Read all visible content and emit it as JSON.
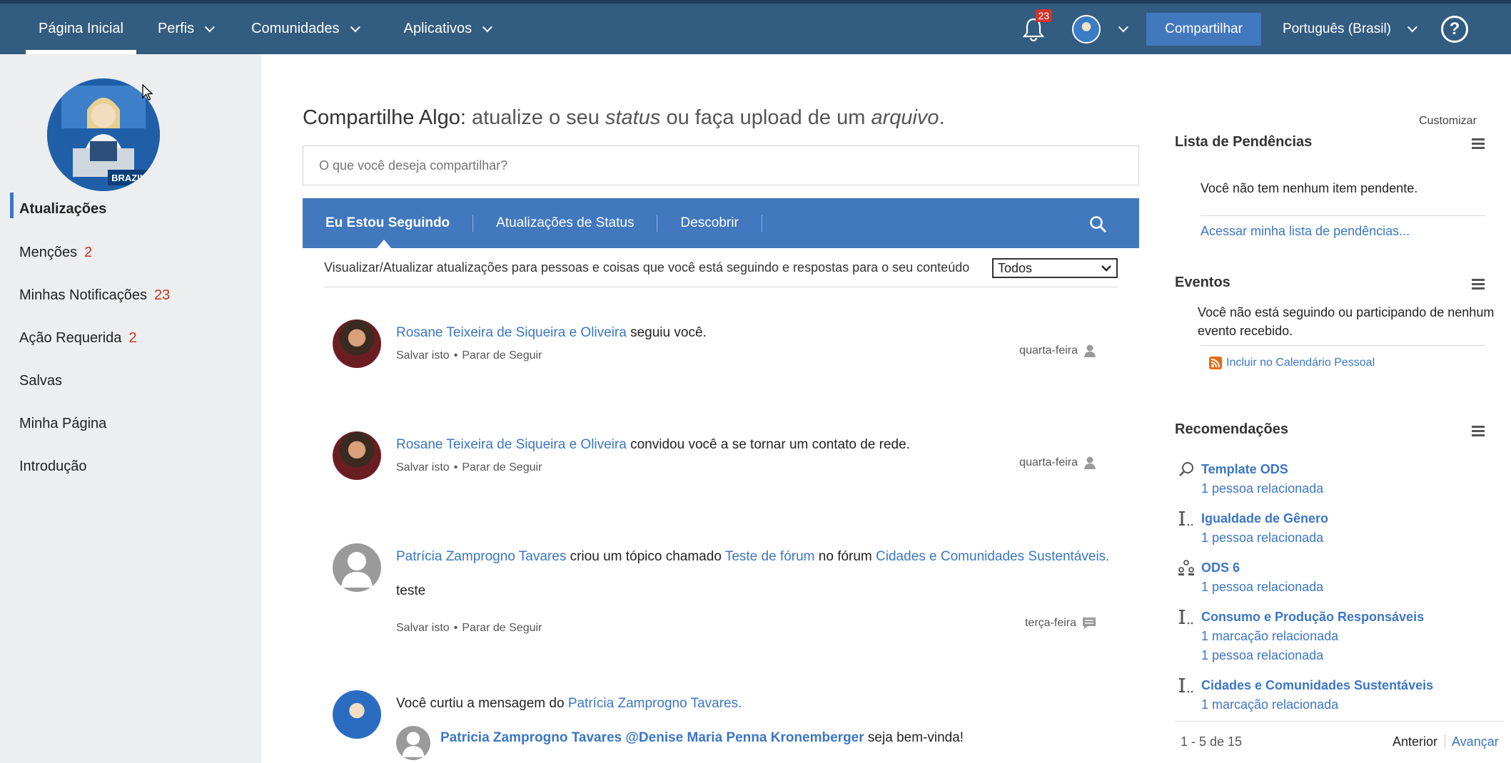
{
  "nav": {
    "home": "Página Inicial",
    "profiles": "Perfis",
    "communities": "Comunidades",
    "apps": "Aplicativos",
    "notifications_count": "23",
    "share": "Compartilhar",
    "language": "Português (Brasil)",
    "help": "?"
  },
  "sidebar": {
    "items": [
      {
        "label": "Atualizações",
        "count": ""
      },
      {
        "label": "Menções",
        "count": "2"
      },
      {
        "label": "Minhas Notificações",
        "count": "23"
      },
      {
        "label": "Ação Requerida",
        "count": "2"
      },
      {
        "label": "Salvas",
        "count": ""
      },
      {
        "label": "Minha Página",
        "count": ""
      },
      {
        "label": "Introdução",
        "count": ""
      }
    ],
    "profile_badge": "BRAZIL"
  },
  "share": {
    "title_a": "Compartilhe Algo:",
    "title_b": "atualize o seu",
    "title_c": "status",
    "title_d": "ou faça upload de um",
    "title_e": "arquivo",
    "title_f": ".",
    "placeholder": "O que você deseja compartilhar?"
  },
  "tabs": {
    "following": "Eu Estou Seguindo",
    "status": "Atualizações de Status",
    "discover": "Descobrir"
  },
  "filter": {
    "text": "Visualizar/Atualizar atualizações para pessoas e coisas que você está seguindo e respostas para o seu conteúdo",
    "selected": "Todos"
  },
  "entries": [
    {
      "actor": "Rosane Teixeira de Siqueira e Oliveira",
      "text": " seguiu você.",
      "save": "Salvar isto",
      "unfollow": "Parar de Seguir",
      "date": "quarta-feira"
    },
    {
      "actor": "Rosane Teixeira de Siqueira e Oliveira",
      "text": " convidou você a se tornar um contato de rede.",
      "save": "Salvar isto",
      "unfollow": "Parar de Seguir",
      "date": "quarta-feira"
    },
    {
      "actor": "Patrícia Zamprogno Tavares",
      "text1": " criou um tópico chamado ",
      "topic": "Teste de fórum",
      "text2": " no fórum ",
      "forum": "Cidades e Comunidades Sustentáveis.",
      "body": "teste",
      "save": "Salvar isto",
      "unfollow": "Parar de Seguir",
      "date": "terça-feira"
    },
    {
      "text": "Você curtiu a mensagem do ",
      "actor": "Patrícia Zamprogno Tavares.",
      "reply_author": "Patricia Zamprogno Tavares @Denise Maria Penna Kronemberger",
      "reply_text": " seja bem-vinda!"
    }
  ],
  "right": {
    "customize": "Customizar",
    "todo_title": "Lista de Pendências",
    "todo_empty": "Você não tem nenhum item pendente.",
    "todo_link": "Acessar minha lista de pendências...",
    "events_title": "Eventos",
    "events_text1": "Você não está seguindo ou participando de nenhum",
    "events_text2": "evento recebido.",
    "events_link": "Incluir no Calendário Pessoal",
    "rec_title": "Recomendações",
    "recommendations": [
      {
        "title": "Template ODS",
        "subs": [
          "1 pessoa relacionada"
        ]
      },
      {
        "title": "Igualdade de Gênero",
        "subs": [
          "1 pessoa relacionada"
        ]
      },
      {
        "title": "ODS 6",
        "subs": [
          "1 pessoa relacionada"
        ]
      },
      {
        "title": "Consumo e Produção Responsáveis",
        "subs": [
          "1 marcação relacionada",
          "1 pessoa relacionada"
        ]
      },
      {
        "title": "Cidades e Comunidades Sustentáveis",
        "subs": [
          "1 marcação relacionada"
        ]
      }
    ],
    "pager_range": "1 - 5 de 15",
    "pager_prev": "Anterior",
    "pager_next": "Avançar"
  },
  "colors": {
    "topbar": "#325c80",
    "accent": "#4178be",
    "link": "#3b76c5",
    "count": "#c4351f"
  }
}
